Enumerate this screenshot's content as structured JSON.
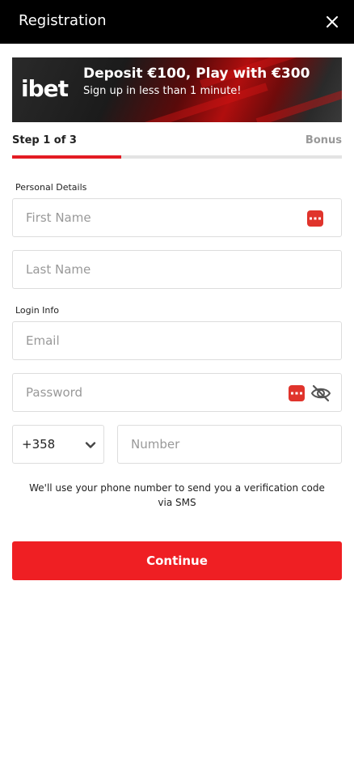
{
  "header": {
    "title": "Registration"
  },
  "banner": {
    "logo_text": "ibet",
    "headline": "Deposit €100, Play with €300",
    "subline": "Sign up in less than 1 minute!"
  },
  "progress": {
    "step_label": "Step 1 of 3",
    "next_label": "Bonus",
    "fraction": 0.33
  },
  "personal": {
    "section_label": "Personal Details",
    "first_name_placeholder": "First Name",
    "last_name_placeholder": "Last Name"
  },
  "login": {
    "section_label": "Login Info",
    "email_placeholder": "Email",
    "password_placeholder": "Password"
  },
  "phone": {
    "country_code": "+358",
    "number_placeholder": "Number",
    "note": "We'll use your phone number to send you a verification code via SMS"
  },
  "actions": {
    "continue_label": "Continue"
  },
  "colors": {
    "accent": "#ef1f23",
    "header_bg": "#000000",
    "border": "#dddddd"
  },
  "icons": [
    "close-icon",
    "password-manager-icon",
    "eye-off-icon",
    "chevron-down-icon"
  ]
}
